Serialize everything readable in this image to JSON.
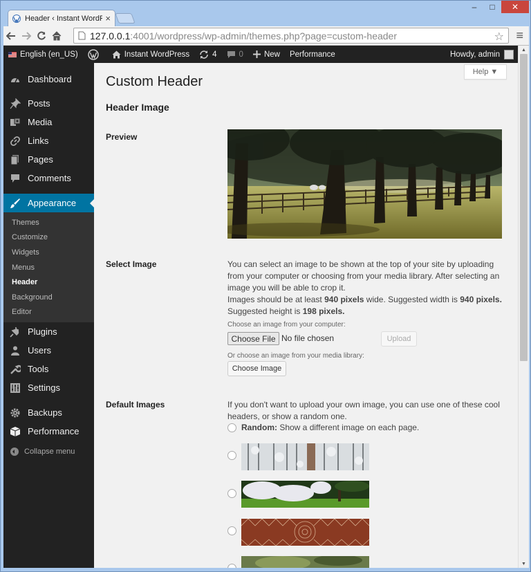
{
  "browser": {
    "tab_title": "Header ‹ Instant WordPres",
    "tab_close": "×",
    "url_host": "127.0.0.1",
    "url_rest": ":4001/wordpress/wp-admin/themes.php?page=custom-header",
    "window_controls": {
      "minimize": "–",
      "maximize": "□",
      "close": "✕"
    }
  },
  "adminbar": {
    "language": "English (en_US)",
    "site_name": "Instant WordPress",
    "updates_count": "4",
    "comments_count": "0",
    "new_label": "New",
    "performance_label": "Performance",
    "howdy": "Howdy, admin"
  },
  "sidebar": {
    "items": [
      {
        "label": "Dashboard",
        "icon": "dashboard-icon"
      },
      {
        "label": "Posts",
        "icon": "pin-icon"
      },
      {
        "label": "Media",
        "icon": "media-icon"
      },
      {
        "label": "Links",
        "icon": "link-icon"
      },
      {
        "label": "Pages",
        "icon": "pages-icon"
      },
      {
        "label": "Comments",
        "icon": "comment-icon"
      },
      {
        "label": "Appearance",
        "icon": "brush-icon"
      }
    ],
    "submenu": [
      "Themes",
      "Customize",
      "Widgets",
      "Menus",
      "Header",
      "Background",
      "Editor"
    ],
    "items2": [
      {
        "label": "Plugins",
        "icon": "plugin-icon"
      },
      {
        "label": "Users",
        "icon": "users-icon"
      },
      {
        "label": "Tools",
        "icon": "wrench-icon"
      },
      {
        "label": "Settings",
        "icon": "settings-icon"
      },
      {
        "label": "Backups",
        "icon": "gear-icon"
      },
      {
        "label": "Performance",
        "icon": "cube-icon"
      }
    ],
    "collapse": "Collapse menu"
  },
  "content": {
    "help": "Help ▼",
    "page_title": "Custom Header",
    "section_title": "Header Image",
    "preview_label": "Preview",
    "select_label": "Select Image",
    "select_text_1": "You can select an image to be shown at the top of your site by uploading from your computer or choosing from your media library. After selecting an image you will be able to crop it.",
    "select_text_2a": "Images should be at least ",
    "select_text_2b": "940 pixels",
    "select_text_2c": " wide. Suggested width is ",
    "select_text_2d": "940 pixels.",
    "select_text_2e": "Suggested height is ",
    "select_text_2f": "198 pixels.",
    "choose_from_computer": "Choose an image from your computer:",
    "choose_file_button": "Choose File",
    "no_file": "No file chosen",
    "upload_button": "Upload",
    "choose_from_library": "Or choose an image from your media library:",
    "choose_image_button": "Choose Image",
    "default_label": "Default Images",
    "default_text": "If you don't want to upload your own image, you can use one of these cool headers, or show a random one.",
    "random_bold": "Random:",
    "random_text": " Show a different image on each page."
  },
  "colors": {
    "adminbar_bg": "#222222",
    "sidebar_bg": "#222222",
    "submenu_bg": "#333333",
    "active_menu": "#0074a2",
    "content_bg": "#f1f1f1"
  }
}
